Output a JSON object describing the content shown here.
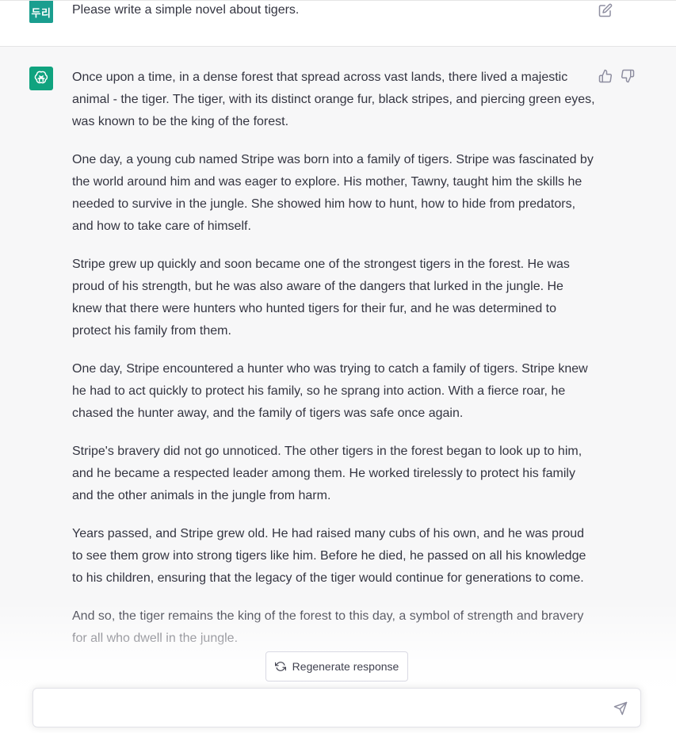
{
  "user": {
    "avatar_text": "두리",
    "message": "Please write a simple novel about tigers."
  },
  "assistant": {
    "paragraphs": [
      "Once upon a time, in a dense forest that spread across vast lands, there lived a majestic animal - the tiger. The tiger, with its distinct orange fur, black stripes, and piercing green eyes, was known to be the king of the forest.",
      "One day, a young cub named Stripe was born into a family of tigers. Stripe was fascinated by the world around him and was eager to explore. His mother, Tawny, taught him the skills he needed to survive in the jungle. She showed him how to hunt, how to hide from predators, and how to take care of himself.",
      "Stripe grew up quickly and soon became one of the strongest tigers in the forest. He was proud of his strength, but he was also aware of the dangers that lurked in the jungle. He knew that there were hunters who hunted tigers for their fur, and he was determined to protect his family from them.",
      "One day, Stripe encountered a hunter who was trying to catch a family of tigers. Stripe knew he had to act quickly to protect his family, so he sprang into action. With a fierce roar, he chased the hunter away, and the family of tigers was safe once again.",
      "Stripe's bravery did not go unnoticed. The other tigers in the forest began to look up to him, and he became a respected leader among them. He worked tirelessly to protect his family and the other animals in the jungle from harm.",
      "Years passed, and Stripe grew old. He had raised many cubs of his own, and he was proud to see them grow into strong tigers like him. Before he died, he passed on all his knowledge to his children, ensuring that the legacy of the tiger would continue for generations to come.",
      "And so, the tiger remains the king of the forest to this day, a symbol of strength and bravery for all who dwell in the jungle."
    ]
  },
  "controls": {
    "regenerate_label": "Regenerate response",
    "input_placeholder": ""
  },
  "colors": {
    "user_avatar_bg": "#1a9e8f",
    "bot_avatar_bg": "#10a37f",
    "assistant_bg": "#f7f7f8"
  }
}
